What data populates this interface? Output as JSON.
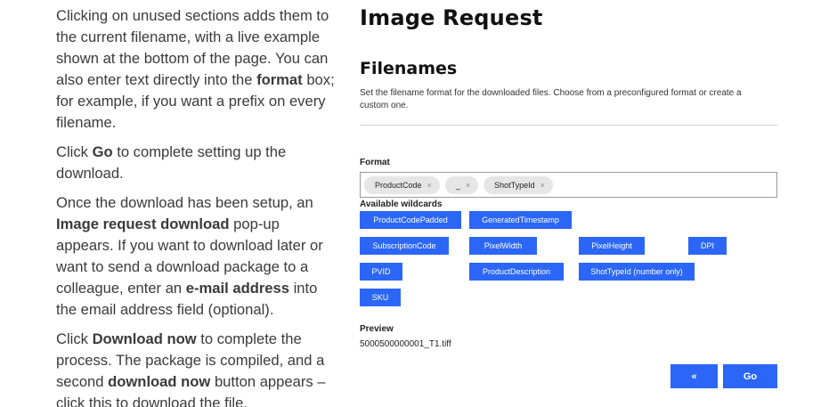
{
  "help": {
    "p1": {
      "t1": "Clicking on unused sections adds them to the current filename, with a live example shown at the bottom of the page. You can also enter text directly into the ",
      "b1": "format",
      "t2": " box; for example, if you want a prefix on every filename."
    },
    "p2": {
      "t1": "Click ",
      "b1": "Go",
      "t2": " to complete setting up the download."
    },
    "p3": {
      "t1": "Once the download has been setup, an ",
      "b1": "Image request download",
      "t2": " pop-up appears. If you want to download later or want to send a download package to a colleague, enter an ",
      "b2": "e-mail address",
      "t3": " into the email address field (optional)."
    },
    "p4": {
      "t1": "Click ",
      "b1": "Download now",
      "t2": " to complete the process. The package is compiled, and a second ",
      "b2": "download now",
      "t3": " button appears – click this to download the file."
    }
  },
  "panel": {
    "title": "Image Request",
    "section_title": "Filenames",
    "description": "Set the filename format for the downloaded files. Choose from a preconfigured format or create a custom one.",
    "format_label": "Format",
    "format_chips": [
      {
        "label": "ProductCode",
        "remove": "×"
      },
      {
        "label": "_",
        "remove": "×"
      },
      {
        "label": "ShotTypeId",
        "remove": "×"
      }
    ],
    "wildcards_label": "Available wildcards",
    "wildcards": [
      "ProductCodePadded",
      "GeneratedTimestamp",
      "SubscriptionCode",
      "PixelWidth",
      "PixelHeight",
      "DPI",
      "PVID",
      "ProductDescription",
      "ShotTypeId (number only)",
      "SKU"
    ],
    "preview_label": "Preview",
    "preview_value": "5000500000001_T1.tiff",
    "back_label": "«",
    "go_label": "Go"
  },
  "colors": {
    "accent": "#2b66f6",
    "chip_bg": "#e6e6e6"
  }
}
